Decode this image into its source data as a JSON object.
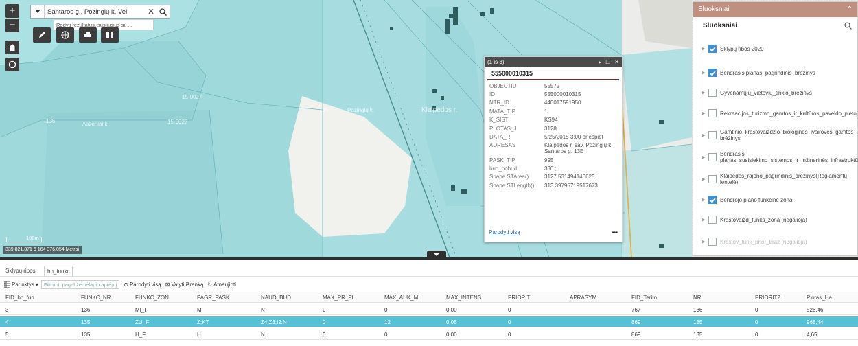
{
  "map": {
    "zoom_in": "+",
    "zoom_out": "−",
    "search": {
      "value": "Santaros g., Pozingių k, Vei",
      "suggestion": "Rodyti rezultatus, susijusius su ..."
    },
    "scale_label": "100m",
    "coords": "339 821,871 6 164 376,054 Metrai",
    "labels": [
      "136",
      "Aszoniai k.",
      "135",
      "15-0027",
      "Pozingių k.",
      "Klaipėdos r.",
      "Klaipėdos r.",
      "15-0027"
    ]
  },
  "popup": {
    "counter": "(1 iš 3)",
    "title": "555000010315",
    "rows": [
      {
        "k": "OBJECTID",
        "v": "55572"
      },
      {
        "k": "ID",
        "v": "555000010315"
      },
      {
        "k": "NTR_ID",
        "v": "440017591950"
      },
      {
        "k": "MATA_TIP",
        "v": "1"
      },
      {
        "k": "K_SIST",
        "v": "KS94"
      },
      {
        "k": "PLOTAS_J",
        "v": "3128"
      },
      {
        "k": "DATA_R",
        "v": "5/25/2015 3:00 priešpiet"
      },
      {
        "k": "ADRESAS",
        "v": "Klaipėdos r. sav. Pozingių k. Santaros g. 13E"
      },
      {
        "k": "PASK_TIP",
        "v": "995"
      },
      {
        "k": "bud_pobud",
        "v": "330 ;"
      },
      {
        "k": "Shape.STArea()",
        "v": "3127.531494140625"
      },
      {
        "k": "Shape.STLength()",
        "v": "313.39795719517673"
      }
    ],
    "show_all": "Parodyti visą",
    "more": "•••"
  },
  "layers": {
    "header": "Sluoksniai",
    "title": "Sluoksniai",
    "items": [
      {
        "label": "Sklypų ribos 2020",
        "checked": true
      },
      {
        "label": "Bendrasis planas_pagrindinis_brėžinys",
        "checked": true
      },
      {
        "label": "Gyvenamųjų_vietovių_tinklo_brėžinys",
        "checked": false
      },
      {
        "label": "Rekreacijos_turizmo_gamtos_ir_kultūros_paveldo_plėtojimo_brėžinys",
        "checked": false
      },
      {
        "label": "Gamtinio_kraštovaizdžio_biologinės_įvairovės_gamtos_ir_kultūros_paveldo brėžinys",
        "checked": false
      },
      {
        "label": "Bendrasis planas_susisiekimo_sistemos_ir_inžinerinės_infrastruktūros_brėžinys",
        "checked": false
      },
      {
        "label": "Klaipėdos_rajono_pagrindinis_brėžinys(Reglamentų lentelė)",
        "checked": false
      },
      {
        "label": "Bendrojo plano funkcinė zona",
        "checked": true
      },
      {
        "label": "Krastovaizd_funks_zona (negalioja)",
        "checked": false
      },
      {
        "label": "Krastov_funk_prior_braz (negalioja)",
        "checked": false
      }
    ]
  },
  "tabs": [
    "Sklypų ribos",
    "bp_funkc"
  ],
  "toolbar": {
    "options": "Parinktys",
    "filter": "Filtruoti pagal žemėlapio aprėptį",
    "zoom_to": "Parodyti visą",
    "clear": "Valyti išranką",
    "refresh": "Atnaujinti"
  },
  "table": {
    "columns": [
      "FID_bp_fun",
      "FUNKC_NR",
      "FUNKC_ZON",
      "PAGR_PASK",
      "NAUD_BUD",
      "MAX_PR_PL",
      "MAX_AUK_M",
      "MAX_INTENS",
      "PRIORIT",
      "APRASYM",
      "FID_Terito",
      "NR",
      "PRIORIT2",
      "Plotas_Ha"
    ],
    "rows": [
      [
        "3",
        "136",
        "MI_F",
        "M",
        "N",
        "0",
        "0",
        "0,00",
        "0",
        "",
        "767",
        "136",
        "0",
        "526,46"
      ],
      [
        "4",
        "135",
        "ZU_F",
        "Z;KT",
        "Z4;Z3;I2:N",
        "0",
        "12",
        "0,05",
        "0",
        "",
        "869",
        "135",
        "0",
        "968,44"
      ],
      [
        "5",
        "135",
        "H_F",
        "H",
        "N",
        "0",
        "0",
        "0,00",
        "0",
        "",
        "869",
        "135",
        "0",
        "4,65"
      ]
    ],
    "selected_row": 1
  }
}
